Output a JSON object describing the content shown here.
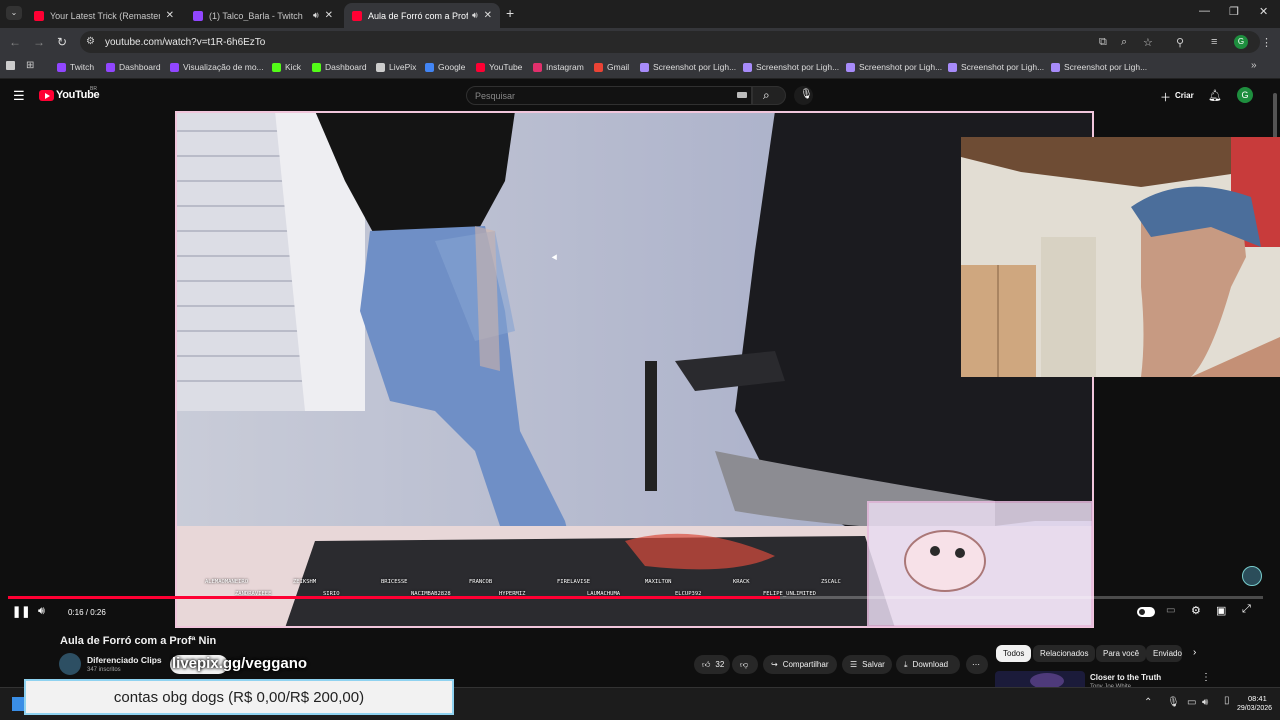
{
  "browser": {
    "tabs": [
      {
        "title": "Your Latest Trick (Remastered 1",
        "color": "#ff0033",
        "speaker": false,
        "active": false
      },
      {
        "title": "(1) Talco_Barla - Twitch",
        "color": "#9146ff",
        "speaker": true,
        "active": false
      },
      {
        "title": "Aula de Forró com a Profª N",
        "color": "#ff0033",
        "speaker": true,
        "active": true
      }
    ],
    "url": "youtube.com/watch?v=t1R-6h6EzTo",
    "bookmarks": [
      {
        "label": "Twitch",
        "color": "#9146ff"
      },
      {
        "label": "Dashboard",
        "color": "#9146ff"
      },
      {
        "label": "Visualização de mo...",
        "color": "#9146ff"
      },
      {
        "label": "Kick",
        "color": "#53fc18"
      },
      {
        "label": "Dashboard",
        "color": "#53fc18"
      },
      {
        "label": "LivePix",
        "color": "#cccccc"
      },
      {
        "label": "Google",
        "color": "#4285f4"
      },
      {
        "label": "YouTube",
        "color": "#ff0033"
      },
      {
        "label": "Instagram",
        "color": "#e1306c"
      },
      {
        "label": "Gmail",
        "color": "#ea4335"
      },
      {
        "label": "Screenshot por Ligh...",
        "color": "#a78bfa"
      },
      {
        "label": "Screenshot por Ligh...",
        "color": "#a78bfa"
      },
      {
        "label": "Screenshot por Ligh...",
        "color": "#a78bfa"
      },
      {
        "label": "Screenshot por Ligh...",
        "color": "#a78bfa"
      },
      {
        "label": "Screenshot por Ligh...",
        "color": "#a78bfa"
      }
    ]
  },
  "youtube": {
    "logo": "YouTube",
    "logo_sup": "BR",
    "search_placeholder": "Pesquisar",
    "create_label": "Criar",
    "avatar_letter": "G"
  },
  "player": {
    "time": "0:16 / 0:26",
    "progress": 0.615
  },
  "video": {
    "title": "Aula de Forró com a Profª Nin",
    "channel": "Diferenciado Clips",
    "subscribers": "347 inscritos",
    "likes": "32",
    "share_label": "Compartilhar",
    "save_label": "Salvar",
    "download_label": "Download"
  },
  "chips": [
    "Todos",
    "Relacionados",
    "Para você",
    "Enviado"
  ],
  "recommendation": {
    "title": "Closer to the Truth",
    "channel": "Tony Joe White"
  },
  "overlay": {
    "donation": "contas obg dogs (R$ 0,00/R$ 200,00)",
    "handle": "livepix.gg/veggano",
    "chat_names": [
      "ALEMAOMANEIRO",
      "ZANDRAVIEEE",
      "ZEIKSHM",
      "SIRIO",
      "BRICESSE",
      "NACIMBAB2828",
      "FRANCOB",
      "HYPERMIZ",
      "FIRELAVISE",
      "LAUMACHUMA",
      "MAXILTON",
      "ELCUP392",
      "KRACK",
      "FELIPE_UNLIMITED",
      "ZSCALC"
    ]
  },
  "taskbar": {
    "time": "08:41",
    "date": "29/03/2026"
  }
}
